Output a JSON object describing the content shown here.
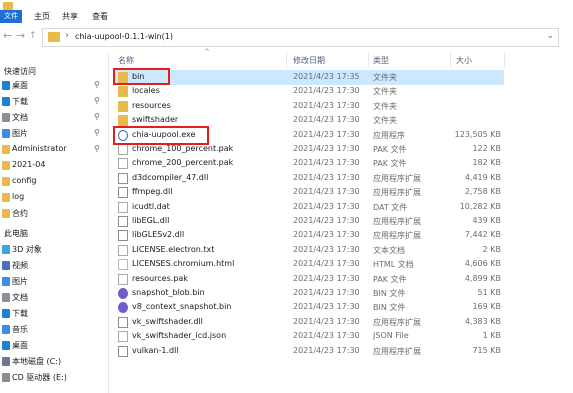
{
  "ribbon": {
    "file_tab": "文件",
    "tabs": [
      "主页",
      "共享",
      "查看"
    ]
  },
  "address": {
    "path": "chia-uupool-0.1.1-win(1)"
  },
  "sidebar": {
    "quick_access": "快速访问",
    "items": [
      {
        "label": "桌面",
        "pinned": true,
        "icon": "desktop-icon"
      },
      {
        "label": "下载",
        "pinned": true,
        "icon": "download-icon"
      },
      {
        "label": "文档",
        "pinned": true,
        "icon": "documents-icon"
      },
      {
        "label": "图片",
        "pinned": true,
        "icon": "pictures-icon"
      },
      {
        "label": "Administrator",
        "pinned": true,
        "icon": "folder-icon"
      },
      {
        "label": "2021-04",
        "pinned": false,
        "icon": "folder-icon"
      },
      {
        "label": "config",
        "pinned": false,
        "icon": "folder-icon"
      },
      {
        "label": "log",
        "pinned": false,
        "icon": "folder-icon"
      },
      {
        "label": "合约",
        "pinned": false,
        "icon": "folder-icon"
      }
    ],
    "this_pc": "此电脑",
    "pc_items": [
      {
        "label": "3D 对象",
        "icon": "3d-objects-icon"
      },
      {
        "label": "视频",
        "icon": "videos-icon"
      },
      {
        "label": "图片",
        "icon": "pictures-icon"
      },
      {
        "label": "文档",
        "icon": "documents-icon"
      },
      {
        "label": "下载",
        "icon": "download-icon"
      },
      {
        "label": "音乐",
        "icon": "music-icon"
      },
      {
        "label": "桌面",
        "icon": "desktop-icon"
      },
      {
        "label": "本地磁盘 (C:)",
        "icon": "drive-icon"
      },
      {
        "label": "CD 驱动器 (E:)",
        "icon": "cd-drive-icon"
      }
    ]
  },
  "columns": {
    "name": "名称",
    "date": "修改日期",
    "type": "类型",
    "size": "大小"
  },
  "files": [
    {
      "name": "bin",
      "date": "2021/4/23 17:35",
      "type": "文件夹",
      "size": "",
      "kind": "folder"
    },
    {
      "name": "locales",
      "date": "2021/4/23 17:30",
      "type": "文件夹",
      "size": "",
      "kind": "folder"
    },
    {
      "name": "resources",
      "date": "2021/4/23 17:30",
      "type": "文件夹",
      "size": "",
      "kind": "folder"
    },
    {
      "name": "swiftshader",
      "date": "2021/4/23 17:30",
      "type": "文件夹",
      "size": "",
      "kind": "folder"
    },
    {
      "name": "chia-uupool.exe",
      "date": "2021/4/23 17:30",
      "type": "应用程序",
      "size": "123,505 KB",
      "kind": "exe"
    },
    {
      "name": "chrome_100_percent.pak",
      "date": "2021/4/23 17:30",
      "type": "PAK 文件",
      "size": "122 KB",
      "kind": "file"
    },
    {
      "name": "chrome_200_percent.pak",
      "date": "2021/4/23 17:30",
      "type": "PAK 文件",
      "size": "182 KB",
      "kind": "file"
    },
    {
      "name": "d3dcompiler_47.dll",
      "date": "2021/4/23 17:30",
      "type": "应用程序扩展",
      "size": "4,419 KB",
      "kind": "dll"
    },
    {
      "name": "ffmpeg.dll",
      "date": "2021/4/23 17:30",
      "type": "应用程序扩展",
      "size": "2,758 KB",
      "kind": "dll"
    },
    {
      "name": "icudtl.dat",
      "date": "2021/4/23 17:30",
      "type": "DAT 文件",
      "size": "10,282 KB",
      "kind": "file"
    },
    {
      "name": "libEGL.dll",
      "date": "2021/4/23 17:30",
      "type": "应用程序扩展",
      "size": "439 KB",
      "kind": "dll"
    },
    {
      "name": "libGLESv2.dll",
      "date": "2021/4/23 17:30",
      "type": "应用程序扩展",
      "size": "7,442 KB",
      "kind": "dll"
    },
    {
      "name": "LICENSE.electron.txt",
      "date": "2021/4/23 17:30",
      "type": "文本文档",
      "size": "2 KB",
      "kind": "file"
    },
    {
      "name": "LICENSES.chromium.html",
      "date": "2021/4/23 17:30",
      "type": "HTML 文档",
      "size": "4,606 KB",
      "kind": "html"
    },
    {
      "name": "resources.pak",
      "date": "2021/4/23 17:30",
      "type": "PAK 文件",
      "size": "4,899 KB",
      "kind": "file"
    },
    {
      "name": "snapshot_blob.bin",
      "date": "2021/4/23 17:30",
      "type": "BIN 文件",
      "size": "51 KB",
      "kind": "bin"
    },
    {
      "name": "v8_context_snapshot.bin",
      "date": "2021/4/23 17:30",
      "type": "BIN 文件",
      "size": "169 KB",
      "kind": "bin"
    },
    {
      "name": "vk_swiftshader.dll",
      "date": "2021/4/23 17:30",
      "type": "应用程序扩展",
      "size": "4,383 KB",
      "kind": "dll"
    },
    {
      "name": "vk_swiftshader_icd.json",
      "date": "2021/4/23 17:30",
      "type": "JSON File",
      "size": "1 KB",
      "kind": "file"
    },
    {
      "name": "vulkan-1.dll",
      "date": "2021/4/23 17:30",
      "type": "应用程序扩展",
      "size": "715 KB",
      "kind": "dll"
    }
  ],
  "colors": {
    "accent": "#1f6ed4",
    "folder": "#e9b949",
    "highlight": "#cce8ff",
    "annotation_red": "#e0201c"
  }
}
